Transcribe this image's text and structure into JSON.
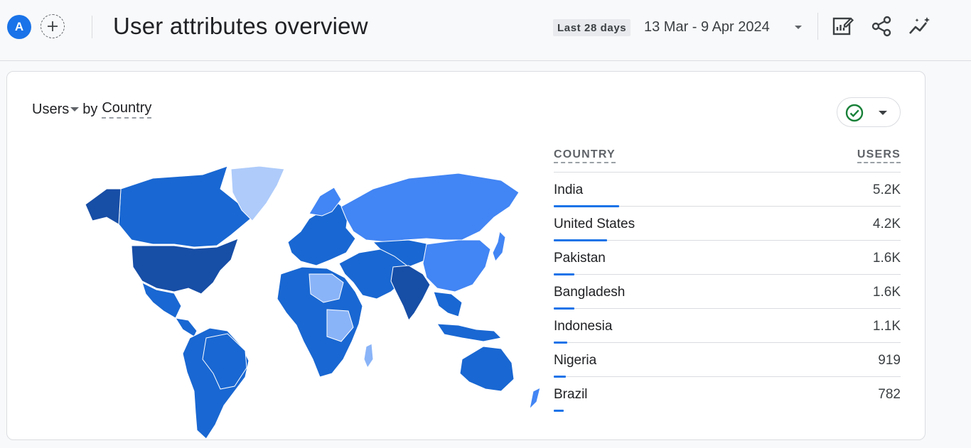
{
  "header": {
    "avatar_letter": "A",
    "title": "User attributes overview",
    "date_chip": "Last 28 days",
    "date_range": "13 Mar - 9 Apr 2024"
  },
  "icons": [
    "plus-icon",
    "chevron-down-icon",
    "edit-report-icon",
    "share-icon",
    "insights-icon",
    "check-circle-icon",
    "world-map"
  ],
  "colors": {
    "accent": "#1a73e8",
    "map_darkest": "#174ea6",
    "map_dark": "#1967d2",
    "map_mid": "#4285f4",
    "map_light": "#8ab4f8",
    "map_lightest": "#aecbfa",
    "status_check": "#188038"
  },
  "card": {
    "metric": "Users",
    "by": "by",
    "dimension": "Country"
  },
  "table": {
    "col_country": "COUNTRY",
    "col_users": "USERS",
    "rows": [
      {
        "country": "India",
        "users": "5.2K",
        "share": 1.0
      },
      {
        "country": "United States",
        "users": "4.2K",
        "share": 0.81
      },
      {
        "country": "Pakistan",
        "users": "1.6K",
        "share": 0.31
      },
      {
        "country": "Bangladesh",
        "users": "1.6K",
        "share": 0.31
      },
      {
        "country": "Indonesia",
        "users": "1.1K",
        "share": 0.21
      },
      {
        "country": "Nigeria",
        "users": "919",
        "share": 0.18
      },
      {
        "country": "Brazil",
        "users": "782",
        "share": 0.15
      }
    ]
  }
}
